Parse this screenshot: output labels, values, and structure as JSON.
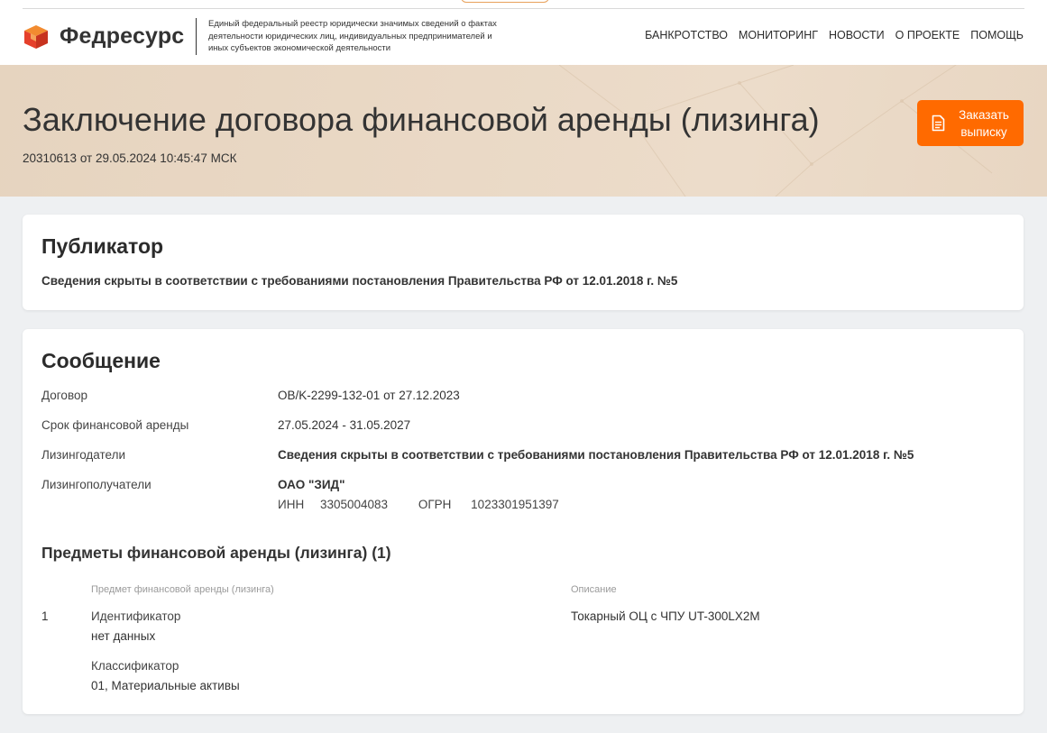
{
  "header": {
    "logo_text": "Федресурс",
    "tagline": "Единый федеральный реестр юридически значимых сведений о фактах деятельности юридических лиц, индивидуальных предпринимателей и иных субъектов экономической деятельности",
    "nav": [
      "БАНКРОТСТВО",
      "МОНИТОРИНГ",
      "НОВОСТИ",
      "О ПРОЕКТЕ",
      "ПОМОЩЬ"
    ]
  },
  "hero": {
    "title": "Заключение договора финансовой аренды (лизинга)",
    "subtitle": "20310613 от 29.05.2024 10:45:47 МСК",
    "order_button_line1": "Заказать",
    "order_button_line2": "выписку"
  },
  "publisher": {
    "title": "Публикатор",
    "text": "Сведения скрыты в соответствии с требованиями постановления Правительства РФ от 12.01.2018 г. №5"
  },
  "message": {
    "title": "Сообщение",
    "rows": [
      {
        "label": "Договор",
        "value": "OB/K-2299-132-01 от 27.12.2023"
      },
      {
        "label": "Срок финансовой аренды",
        "value": "27.05.2024 - 31.05.2027"
      },
      {
        "label": "Лизингодатели",
        "value": "Сведения скрыты в соответствии с требованиями постановления Правительства РФ от 12.01.2018 г. №5"
      },
      {
        "label": "Лизингополучатели",
        "value": "ОАО \"ЗИД\""
      }
    ],
    "lessee_meta": {
      "inn_label": "ИНН",
      "inn": "3305004083",
      "ogrn_label": "ОГРН",
      "ogrn": "1023301951397"
    },
    "items_title": "Предметы финансовой аренды (лизинга) (1)",
    "items_headers": [
      "Предмет финансовой аренды (лизинга)",
      "Описание"
    ],
    "items": [
      {
        "num": "1",
        "id_label": "Идентификатор",
        "id_value": "нет данных",
        "class_label": "Классификатор",
        "class_value": "01, Материальные активы",
        "description": "Токарный ОЦ с ЧПУ UT-300LX2M"
      }
    ]
  },
  "colors": {
    "accent": "#ff6a00",
    "logo_red": "#e5402b",
    "logo_orange": "#f28b30"
  },
  "icons": {
    "logo": "fedresurs-cube-icon",
    "order": "document-icon"
  }
}
